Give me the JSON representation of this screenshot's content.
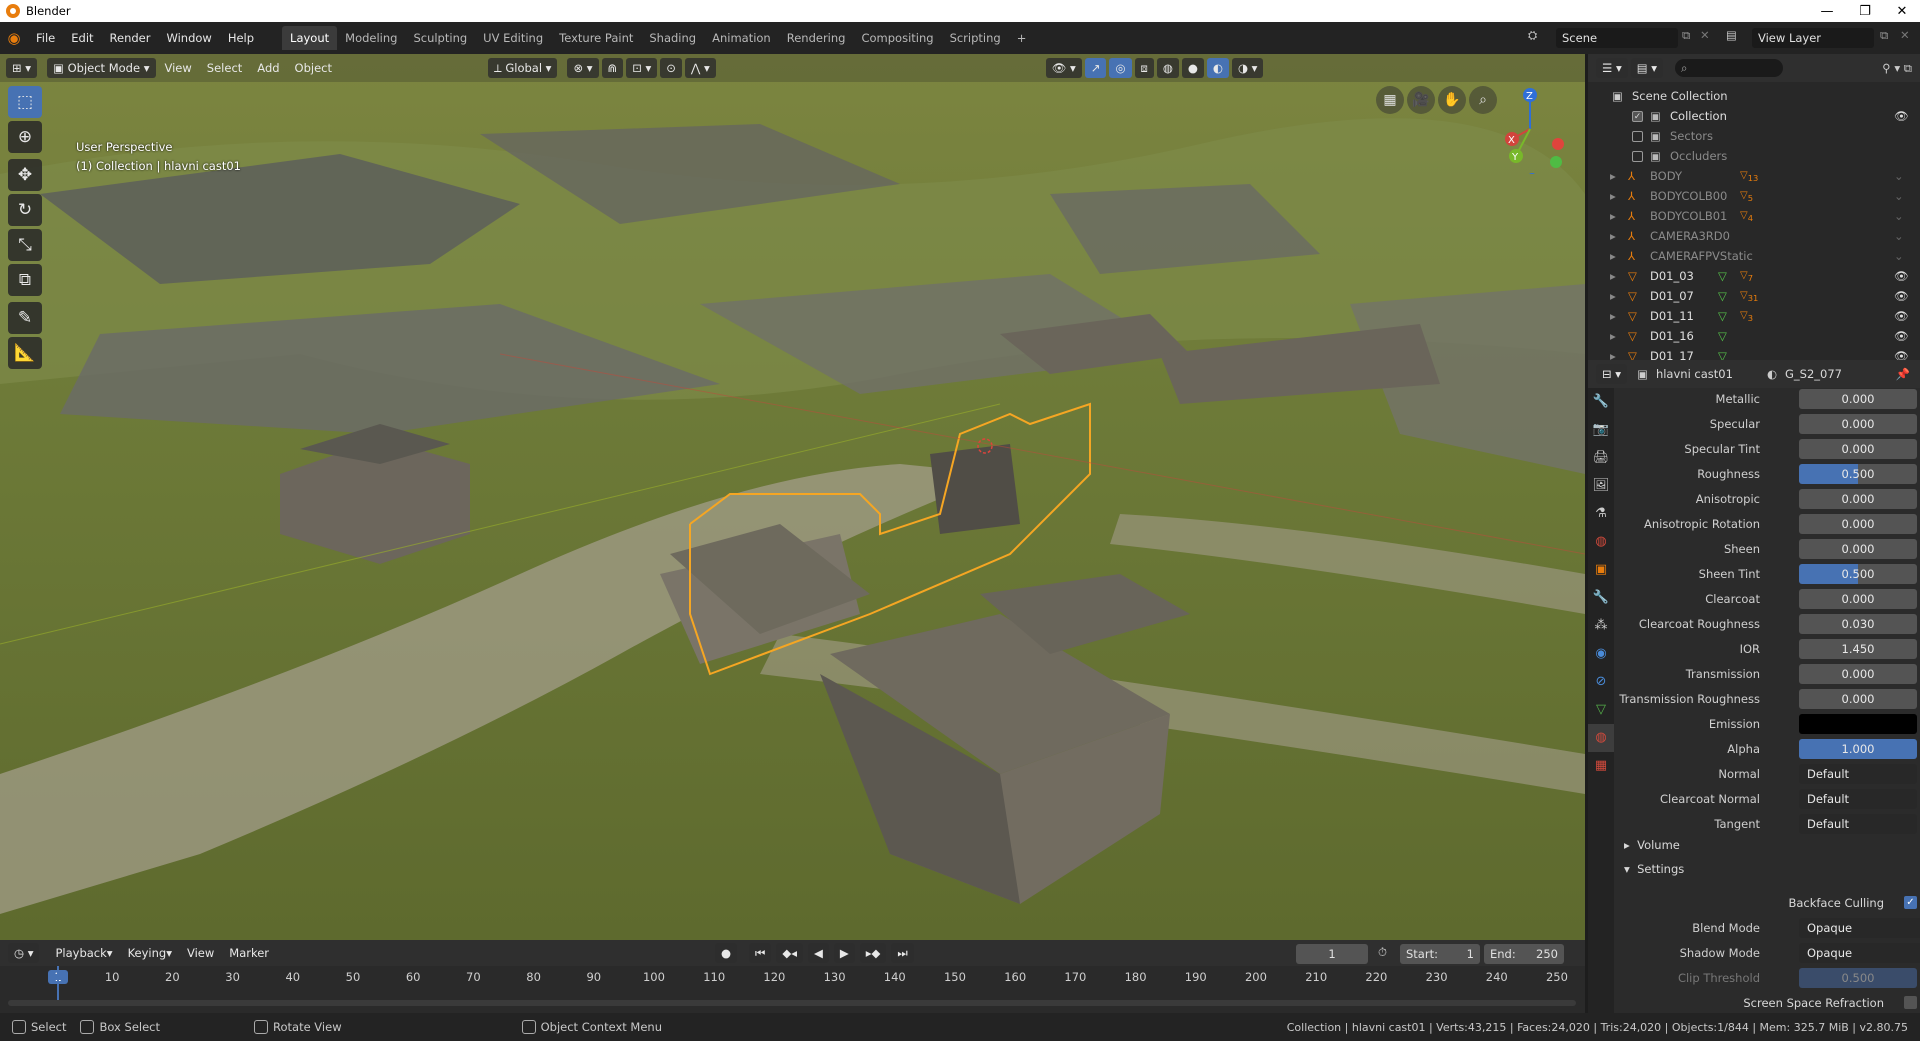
{
  "window": {
    "title": "Blender",
    "minimize": "—",
    "restore": "❐",
    "close": "✕"
  },
  "menubar": {
    "items": [
      "File",
      "Edit",
      "Render",
      "Window",
      "Help"
    ]
  },
  "workspaces": {
    "items": [
      "Layout",
      "Modeling",
      "Sculpting",
      "UV Editing",
      "Texture Paint",
      "Shading",
      "Animation",
      "Rendering",
      "Compositing",
      "Scripting"
    ],
    "active": "Layout",
    "add": "+"
  },
  "scene": {
    "name": "Scene",
    "view_layer": "View Layer"
  },
  "viewport": {
    "mode": "Object Mode",
    "menus": [
      "View",
      "Select",
      "Add",
      "Object"
    ],
    "orientation": "Global",
    "info_line1": "User Perspective",
    "info_line2": "(1) Collection | hlavni cast01",
    "gizmo": {
      "x": "X",
      "y": "Y",
      "z": "Z"
    }
  },
  "outliner": {
    "root": "Scene Collection",
    "items": [
      {
        "name": "Collection",
        "badge": "",
        "checked": true,
        "dim": false
      },
      {
        "name": "Sectors",
        "badge": "",
        "checked": false,
        "dim": true
      },
      {
        "name": "Occluders",
        "badge": "",
        "checked": false,
        "dim": true
      },
      {
        "name": "BODY",
        "badge": "13",
        "dim": true
      },
      {
        "name": "BODYCOLB00",
        "badge": "5",
        "dim": true
      },
      {
        "name": "BODYCOLB01",
        "badge": "4",
        "dim": true
      },
      {
        "name": "CAMERA3RD0",
        "badge": "",
        "dim": true
      },
      {
        "name": "CAMERAFPVStatic",
        "badge": "",
        "dim": true
      },
      {
        "name": "D01_03",
        "badge": "7",
        "dim": false
      },
      {
        "name": "D01_07",
        "badge": "31",
        "dim": false
      },
      {
        "name": "D01_11",
        "badge": "3",
        "dim": false
      },
      {
        "name": "D01_16",
        "badge": "",
        "dim": false
      },
      {
        "name": "D01_17",
        "badge": "",
        "dim": false
      }
    ]
  },
  "properties": {
    "object": "hlavni cast01",
    "material": "G_S2_077",
    "rows": [
      {
        "label": "Metallic",
        "value": "0.000",
        "style": ""
      },
      {
        "label": "Specular",
        "value": "0.000",
        "style": ""
      },
      {
        "label": "Specular Tint",
        "value": "0.000",
        "style": ""
      },
      {
        "label": "Roughness",
        "value": "0.500",
        "style": "blue"
      },
      {
        "label": "Anisotropic",
        "value": "0.000",
        "style": ""
      },
      {
        "label": "Anisotropic Rotation",
        "value": "0.000",
        "style": ""
      },
      {
        "label": "Sheen",
        "value": "0.000",
        "style": ""
      },
      {
        "label": "Sheen Tint",
        "value": "0.500",
        "style": "blue"
      },
      {
        "label": "Clearcoat",
        "value": "0.000",
        "style": ""
      },
      {
        "label": "Clearcoat Roughness",
        "value": "0.030",
        "style": ""
      },
      {
        "label": "IOR",
        "value": "1.450",
        "style": ""
      },
      {
        "label": "Transmission",
        "value": "0.000",
        "style": ""
      },
      {
        "label": "Transmission Roughness",
        "value": "0.000",
        "style": ""
      },
      {
        "label": "Emission",
        "value": "",
        "style": "black"
      },
      {
        "label": "Alpha",
        "value": "1.000",
        "style": "full"
      },
      {
        "label": "Normal",
        "value": "Default",
        "style": "sel"
      },
      {
        "label": "Clearcoat Normal",
        "value": "Default",
        "style": "sel"
      },
      {
        "label": "Tangent",
        "value": "Default",
        "style": "sel"
      }
    ],
    "volume": "Volume",
    "settings": "Settings",
    "backface_culling": "Backface Culling",
    "blend_mode_label": "Blend Mode",
    "blend_mode": "Opaque",
    "shadow_mode_label": "Shadow Mode",
    "shadow_mode": "Opaque",
    "clip_threshold_label": "Clip Threshold",
    "clip_threshold": "0.500",
    "screen_space_refraction": "Screen Space Refraction"
  },
  "timeline": {
    "menus": [
      "Playback",
      "Keying",
      "View",
      "Marker"
    ],
    "current_frame": "1",
    "start_label": "Start:",
    "start": "1",
    "end_label": "End:",
    "end": "250",
    "ticks": [
      "1",
      "10",
      "20",
      "30",
      "40",
      "50",
      "60",
      "70",
      "80",
      "90",
      "100",
      "110",
      "120",
      "130",
      "140",
      "150",
      "160",
      "170",
      "180",
      "190",
      "200",
      "210",
      "220",
      "230",
      "240",
      "250"
    ]
  },
  "statusbar": {
    "select": "Select",
    "box_select": "Box Select",
    "rotate_view": "Rotate View",
    "context_menu": "Object Context Menu",
    "stats": "Collection | hlavni cast01 | Verts:43,215 | Faces:24,020 | Tris:24,020 | Objects:1/844 | Mem: 325.7 MiB | v2.80.75"
  },
  "colors": {
    "accent": "#4772b3",
    "selection": "#f5a623",
    "header": "#232323"
  }
}
